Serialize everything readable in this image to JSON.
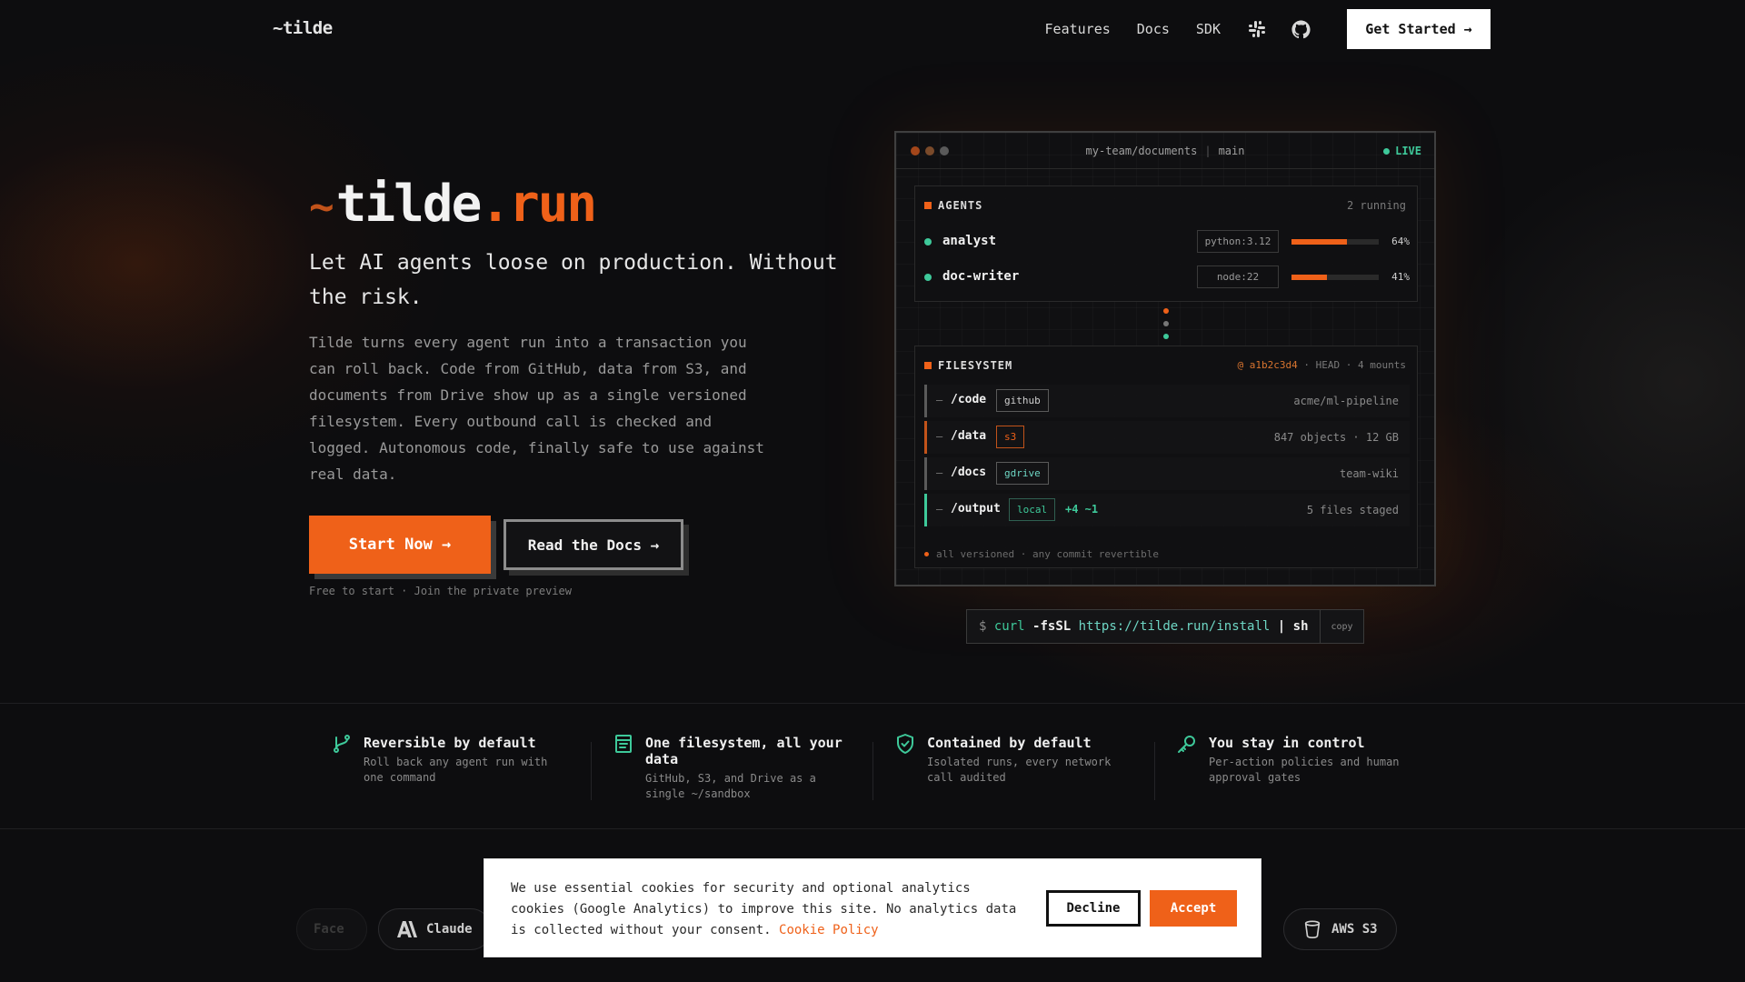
{
  "nav": {
    "logo": "~tilde",
    "links": [
      "Features",
      "Docs",
      "SDK"
    ],
    "icons": [
      "slack-icon",
      "github-icon"
    ],
    "cta": "Get Started →"
  },
  "hero": {
    "brand_tilde": "~",
    "brand_name": "tilde",
    "brand_suffix": ".run",
    "tagline": "Let AI agents loose on production. Without the risk.",
    "description": "Tilde turns every agent run into a transaction you can roll back. Code from GitHub, data from S3, and documents from Drive show up as a single versioned filesystem. Every outbound call is checked and logged. Autonomous code, finally safe to use against real data.",
    "primary_button": "Start Now →",
    "secondary_button": "Read the Docs →",
    "note": "Free to start · Join the private preview"
  },
  "panel": {
    "path": "my-team/documents",
    "branch": "main",
    "status": "LIVE",
    "agents": {
      "title": "AGENTS",
      "meta": "2 running",
      "items": [
        {
          "name": "analyst",
          "env": "python:3.12",
          "progress": 0.64,
          "pct": "64%"
        },
        {
          "name": "doc-writer",
          "env": "node:22",
          "progress": 0.41,
          "pct": "41%"
        }
      ]
    },
    "filesystem": {
      "title": "FILESYSTEM",
      "hash": "@ a1b2c3d4",
      "meta": "· HEAD · 4 mounts",
      "mounts": [
        {
          "path": "/code",
          "tag": "github",
          "extra": "",
          "info": "acme/ml-pipeline",
          "accent": "#5a5a5a",
          "tag_color": "#cfcfcf",
          "tag_border": "#5a5a5a"
        },
        {
          "path": "/data",
          "tag": "s3",
          "extra": "",
          "info": "847 objects · 12 GB",
          "accent": "#c2531a",
          "tag_color": "#ef6119",
          "tag_border": "#c2531a"
        },
        {
          "path": "/docs",
          "tag": "gdrive",
          "extra": "",
          "info": "team-wiki",
          "accent": "#5a5a5a",
          "tag_color": "#6ed6c4",
          "tag_border": "#5a5a5a"
        },
        {
          "path": "/output",
          "tag": "local",
          "extra": "+4 ~1",
          "info": "5 files staged",
          "accent": "#3ec99a",
          "tag_color": "#3ec99a",
          "tag_border": "#2f5f50"
        }
      ],
      "footer": "all versioned · any commit revertible"
    }
  },
  "install": {
    "dollar": "$",
    "cmd": "curl",
    "flag": "-fsSL",
    "url": "https://tilde.run/install",
    "pipe": "| sh",
    "copy": "copy"
  },
  "features": [
    {
      "icon": "branch-icon",
      "title": "Reversible by default",
      "desc": "Roll back any agent run with one command"
    },
    {
      "icon": "file-icon",
      "title": "One filesystem, all your data",
      "desc": "GitHub, S3, and Drive as a single ~/sandbox"
    },
    {
      "icon": "shield-icon",
      "title": "Contained by default",
      "desc": "Isolated runs, every network call audited"
    },
    {
      "icon": "key-icon",
      "title": "You stay in control",
      "desc": "Per-action policies and human approval gates"
    }
  ],
  "logos": {
    "faded": "Face",
    "claude": "Claude",
    "aws": "AWS S3"
  },
  "cookie": {
    "text": "We use essential cookies for security and optional analytics cookies (Google Analytics) to improve this site. No analytics data is collected without your consent.",
    "link": "Cookie Policy",
    "decline": "Decline",
    "accept": "Accept"
  },
  "colors": {
    "accent": "#ef6119",
    "green": "#3ec99a",
    "background": "#0d0d0f"
  }
}
